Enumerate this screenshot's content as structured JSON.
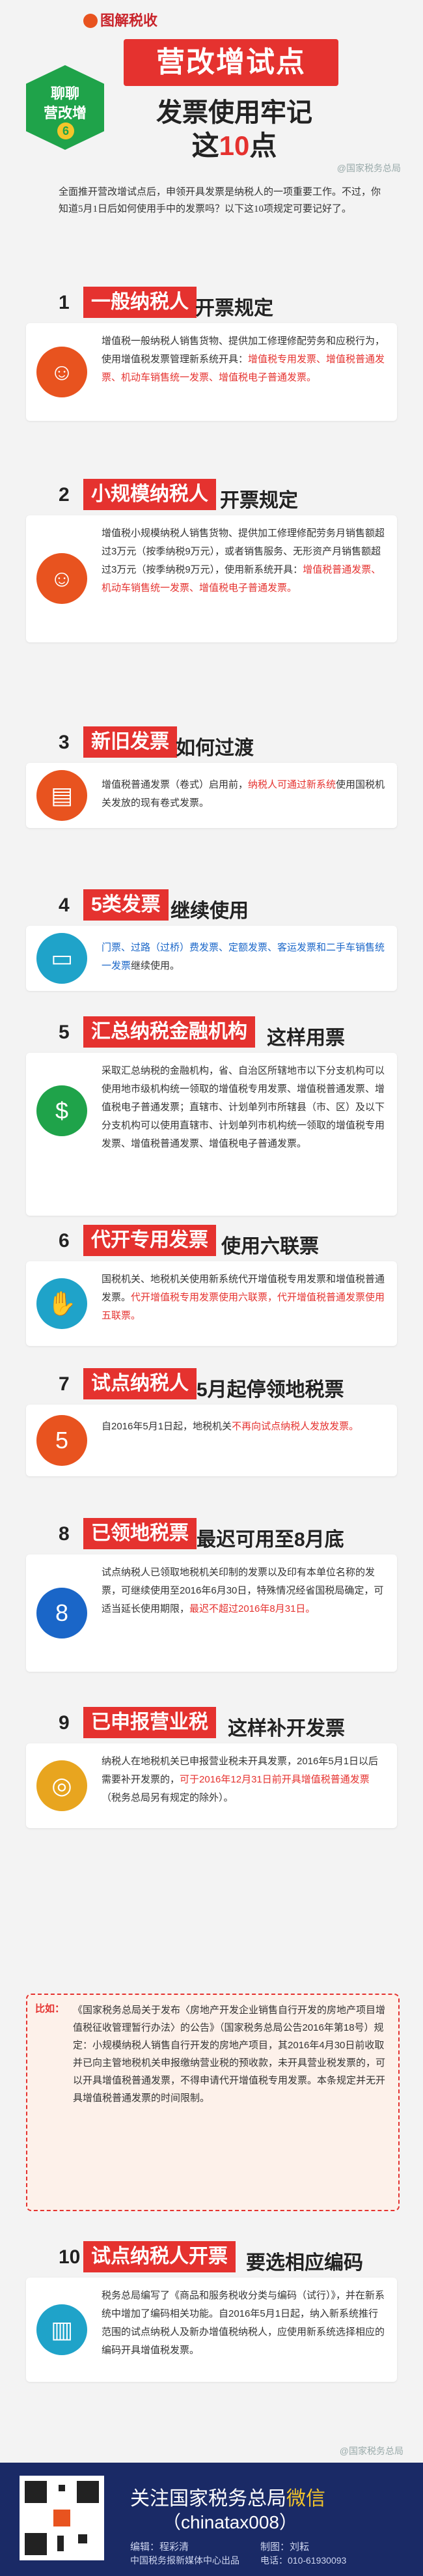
{
  "header": {
    "brand": "图解税收",
    "badge_line1": "聊聊",
    "badge_line2": "营改增",
    "badge_num": "6",
    "title": "营改增试点",
    "subtitle": "发票使用牢记",
    "subtitle2_pre": "这",
    "subtitle2_num": "10",
    "subtitle2_post": "点",
    "watermark": "@国家税务总局"
  },
  "intro": "全面推开营改增试点后，申领开具发票是纳税人的一项重要工作。不过，你知道5月1日后如何使用手中的发票吗？以下这10项规定可要记好了。",
  "sections": [
    {
      "n": "1",
      "tag": "一般纳税人",
      "rest": "开票规定",
      "text": "增值税一般纳税人销售货物、提供加工修理修配劳务和应税行为，使用增值税发票管理新系统开具：",
      "red": "增值税专用发票、增值税普通发票、机动车销售统一发票、增值税电子普通发票。"
    },
    {
      "n": "2",
      "tag": "小规模纳税人",
      "rest": "开票规定",
      "text": "增值税小规模纳税人销售货物、提供加工修理修配劳务月销售额超过3万元（按季纳税9万元），或者销售服务、无形资产月销售额超过3万元（按季纳税9万元），使用新系统开具：",
      "red": "增值税普通发票、机动车销售统一发票、增值税电子普通发票。"
    },
    {
      "n": "3",
      "tag": "新旧发票",
      "rest": "如何过渡",
      "text": "增值税普通发票（卷式）启用前，",
      "red": "纳税人可通过新系统",
      "text2": "使用国税机关发放的现有卷式发票。"
    },
    {
      "n": "4",
      "tag": "5类发票",
      "rest": "继续使用",
      "blue": "门票、过路（过桥）费发票、定额发票、客运发票和二手车销售统一发票",
      "text": "继续使用。"
    },
    {
      "n": "5",
      "tag": "汇总纳税金融机构",
      "rest": "这样用票",
      "text": "采取汇总纳税的金融机构，省、自治区所辖地市以下分支机构可以使用地市级机构统一领取的增值税专用发票、增值税普通发票、增值税电子普通发票；直辖市、计划单列市所辖县（市、区）及以下分支机构可以使用直辖市、计划单列市机构统一领取的增值税专用发票、增值税普通发票、增值税电子普通发票。"
    },
    {
      "n": "6",
      "tag": "代开专用发票",
      "rest": "使用六联票",
      "text": "国税机关、地税机关使用新系统代开增值税专用发票和增值税普通发票。",
      "red": "代开增值税专用发票使用六联票，代开增值税普通发票使用五联票。"
    },
    {
      "n": "7",
      "tag": "试点纳税人",
      "rest": "5月起停领地税票",
      "text": "自2016年5月1日起，地税机关",
      "red": "不再向试点纳税人发放发票。"
    },
    {
      "n": "8",
      "tag": "已领地税票",
      "rest": "最迟可用至8月底",
      "text": "试点纳税人已领取地税机关印制的发票以及印有本单位名称的发票，可继续使用至2016年6月30日，特殊情况经省国税局确定，可适当延长使用期限，",
      "red": "最迟不超过2016年8月31日。"
    },
    {
      "n": "9",
      "tag": "已申报营业税",
      "rest": "这样补开发票",
      "text": "纳税人在地税机关已申报营业税未开具发票，2016年5月1日以后需要补开发票的，",
      "red": "可于2016年12月31日前开具增值税普通发票",
      "text2": "（税务总局另有规定的除外）。"
    },
    {
      "n": "10",
      "tag": "试点纳税人开票",
      "rest": "要选相应编码",
      "text": "税务总局编写了《商品和服务税收分类与编码（试行）》，并在新系统中增加了编码相关功能。自2016年5月1日起，纳入新系统推行范围的试点纳税人及新办增值税纳税人，应使用新系统选择相应的编码开具增值税发票。"
    }
  ],
  "note": {
    "label": "比如：",
    "text": "《国家税务总局关于发布〈房地产开发企业销售自行开发的房地产项目增值税征收管理暂行办法〉的公告》（国家税务总局公告2016年第18号）规定：小规模纳税人销售自行开发的房地产项目，其2016年4月30日前收取并已向主管地税机关申报缴纳营业税的预收款，未开具营业税发票的，可以开具增值税普通发票，不得申请代开增值税专用发票。本条规定并无开具增值税普通发票的时间限制。"
  },
  "footer": {
    "line1_pre": "关注国家税务总局",
    "line1_hi": "微信",
    "line2": "（chinatax008）",
    "editor": "编辑：程彩清",
    "maker": "制图：刘耘",
    "org": "中国税务报新媒体中心出品",
    "phone": "电话：010-61930093",
    "watermark": "@国家税务总局"
  }
}
